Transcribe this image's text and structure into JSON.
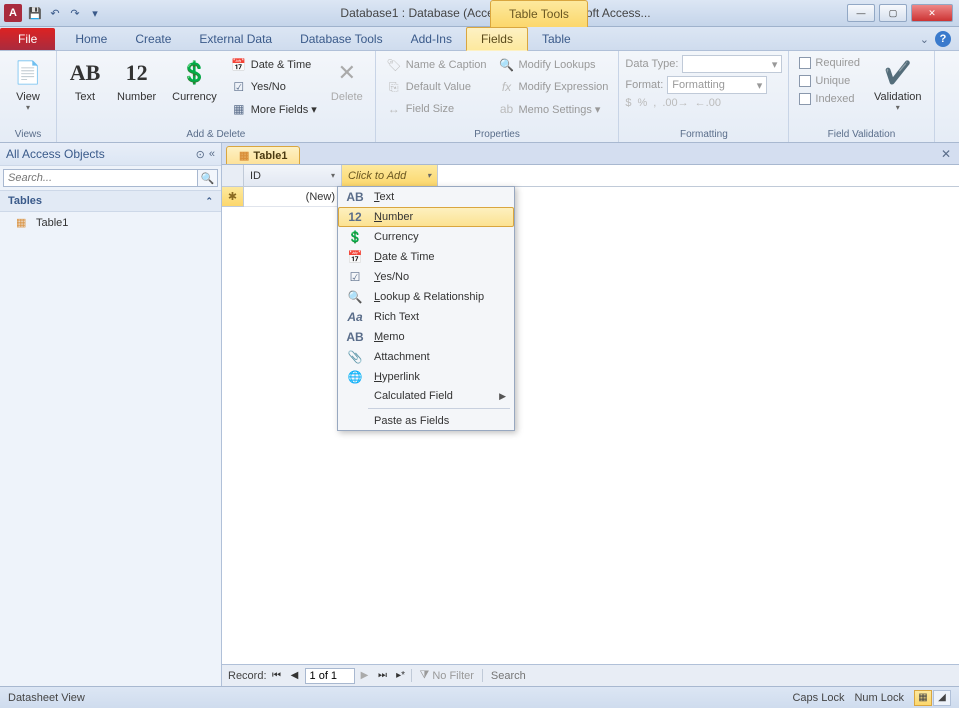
{
  "title": "Database1 : Database (Access 2007)  -  Microsoft Access...",
  "table_tools": "Table Tools",
  "window_controls": {
    "min": "—",
    "max": "▢",
    "close": "✕"
  },
  "tabs": {
    "file": "File",
    "home": "Home",
    "create": "Create",
    "external_data": "External Data",
    "database_tools": "Database Tools",
    "addins": "Add-Ins",
    "fields": "Fields",
    "table": "Table"
  },
  "ribbon": {
    "views": {
      "view": "View",
      "group": "Views"
    },
    "add_delete": {
      "text": "Text",
      "number": "Number",
      "currency": "Currency",
      "date_time": "Date & Time",
      "yes_no": "Yes/No",
      "more_fields": "More Fields ▾",
      "delete": "Delete",
      "group": "Add & Delete"
    },
    "properties": {
      "name_caption": "Name & Caption",
      "default_value": "Default Value",
      "field_size": "Field Size",
      "modify_lookups": "Modify Lookups",
      "modify_expression": "Modify Expression",
      "memo_settings": "Memo Settings ▾",
      "group": "Properties"
    },
    "formatting": {
      "data_type": "Data Type:",
      "format": "Format:",
      "format_ph": "Formatting",
      "group": "Formatting"
    },
    "validation": {
      "required": "Required",
      "unique": "Unique",
      "indexed": "Indexed",
      "validation": "Validation",
      "group": "Field Validation"
    }
  },
  "nav": {
    "title": "All Access Objects",
    "search_ph": "Search...",
    "group": "Tables",
    "item1": "Table1"
  },
  "doc": {
    "tab": "Table1",
    "col_id": "ID",
    "col_add": "Click to Add",
    "new_row": "(New)"
  },
  "dropdown": {
    "text": "Text",
    "number": "Number",
    "currency": "Currency",
    "date_time": "Date & Time",
    "yes_no": "Yes/No",
    "lookup": "Lookup & Relationship",
    "rich_text": "Rich Text",
    "memo": "Memo",
    "attachment": "Attachment",
    "hyperlink": "Hyperlink",
    "calculated": "Calculated Field",
    "paste": "Paste as Fields"
  },
  "record_nav": {
    "label": "Record:",
    "pos": "1 of 1",
    "no_filter": "No Filter",
    "search": "Search"
  },
  "status": {
    "view": "Datasheet View",
    "caps": "Caps Lock",
    "num": "Num Lock"
  }
}
